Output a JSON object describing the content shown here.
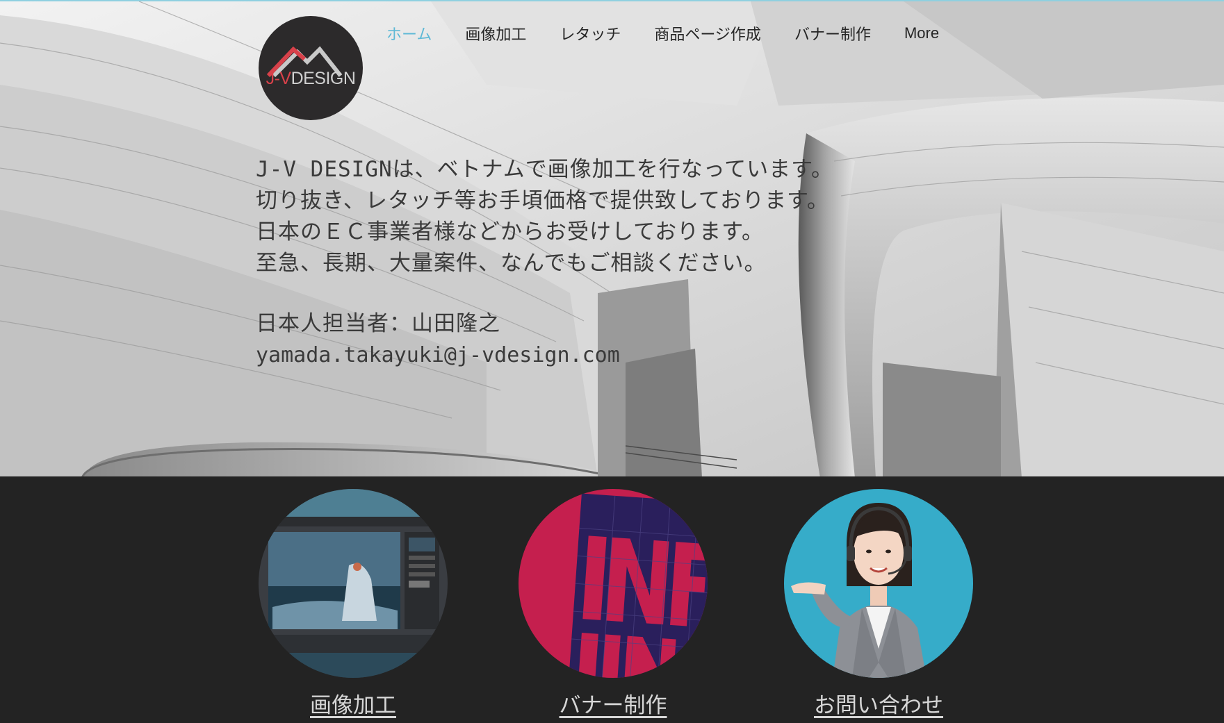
{
  "site": {
    "logo": {
      "text_a": "J-V",
      "text_b": "DESIGN",
      "colors": {
        "accent": "#d8414a",
        "light": "#d0d0d0",
        "bg": "#2c2a2b"
      }
    }
  },
  "nav": {
    "items": [
      {
        "label": "ホーム",
        "active": true
      },
      {
        "label": "画像加工"
      },
      {
        "label": "レタッチ"
      },
      {
        "label": "商品ページ作成"
      },
      {
        "label": "バナー制作"
      },
      {
        "label": "More"
      }
    ],
    "active_color": "#5fb9d6"
  },
  "hero": {
    "lines": [
      "J-V DESIGNは、ベトナムで画像加工を行なっています。",
      "切り抜き、レタッチ等お手頃価格で提供致しております。",
      "日本のＥＣ事業者様などからお受けしております。",
      "至急、長期、大量案件、なんでもご相談ください。"
    ],
    "contact_person": "日本人担当者：山田隆之",
    "email": "yamada.takayuki@j-vdesign.com"
  },
  "services": [
    {
      "label": "画像加工",
      "image": "photo-editing-screenshot"
    },
    {
      "label": "バナー制作",
      "image": "banner-typography"
    },
    {
      "label": "お問い合わせ",
      "image": "support-operator"
    }
  ]
}
